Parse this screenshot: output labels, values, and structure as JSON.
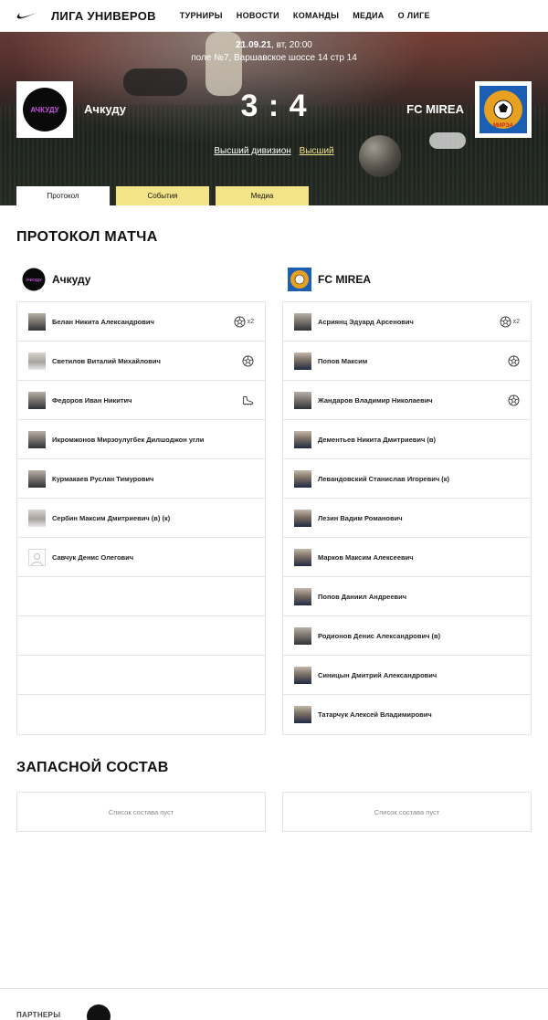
{
  "header": {
    "brand": "ЛИГА УНИВЕРОВ",
    "nav": [
      "ТУРНИРЫ",
      "НОВОСТИ",
      "КОМАНДЫ",
      "МЕДИА",
      "О ЛИГЕ"
    ]
  },
  "match": {
    "date": "21.09.21",
    "date_suffix": ", вт, 20:00",
    "venue": "поле №7, Варшавское шоссе 14 стр 14",
    "home_team": "Ачкуду",
    "away_team": "FC MIREA",
    "score": "3 : 4",
    "division_link_1": "Высший дивизион",
    "division_link_2": "Высший",
    "home_logo_text": "АЧКУДУ",
    "away_logo_text": "МИРЭА"
  },
  "tabs": [
    "Протокол",
    "События",
    "Медиа"
  ],
  "protocol": {
    "title": "ПРОТОКОЛ МАТЧА",
    "home": [
      {
        "name": "Белан Никита Александрович",
        "event": "goal",
        "count": "x2",
        "avatar": "dark"
      },
      {
        "name": "Светилов Виталий Михайлович",
        "event": "goal",
        "count": "",
        "avatar": "light"
      },
      {
        "name": "Федоров Иван Никитич",
        "event": "boot",
        "count": "",
        "avatar": "dark"
      },
      {
        "name": "Икромжонов Мирзоулугбек Дилшоджон угли",
        "event": "",
        "count": "",
        "avatar": "dark"
      },
      {
        "name": "Курмакаев Руслан Тимурович",
        "event": "",
        "count": "",
        "avatar": "dark"
      },
      {
        "name": "Сербин Максим Дмитриевич (в) (к)",
        "event": "",
        "count": "",
        "avatar": "light"
      },
      {
        "name": "Савчук Денис Олегович",
        "event": "",
        "count": "",
        "avatar": "placeholder"
      },
      {
        "name": "",
        "event": "",
        "count": "",
        "avatar": "none"
      },
      {
        "name": "",
        "event": "",
        "count": "",
        "avatar": "none"
      },
      {
        "name": "",
        "event": "",
        "count": "",
        "avatar": "none"
      },
      {
        "name": "",
        "event": "",
        "count": "",
        "avatar": "none"
      }
    ],
    "away": [
      {
        "name": "Асриянц Эдуард Арсенович",
        "event": "goal",
        "count": "x2",
        "avatar": "dark"
      },
      {
        "name": "Попов Максим",
        "event": "goal",
        "count": "",
        "avatar": "navy"
      },
      {
        "name": "Жандаров Владимир Николаевич",
        "event": "goal",
        "count": "",
        "avatar": "dark"
      },
      {
        "name": "Дементьев Никита Дмитриевич (в)",
        "event": "",
        "count": "",
        "avatar": "navy"
      },
      {
        "name": "Левандовский Станислав Игоревич (к)",
        "event": "",
        "count": "",
        "avatar": "navy"
      },
      {
        "name": "Лезин Вадим Романович",
        "event": "",
        "count": "",
        "avatar": "navy"
      },
      {
        "name": "Марков Максим Алексеевич",
        "event": "",
        "count": "",
        "avatar": "navy"
      },
      {
        "name": "Попов Даниил Андреевич",
        "event": "",
        "count": "",
        "avatar": "navy"
      },
      {
        "name": "Родионов Денис Александрович (в)",
        "event": "",
        "count": "",
        "avatar": "dark"
      },
      {
        "name": "Синицын Дмитрий Александрович",
        "event": "",
        "count": "",
        "avatar": "navy"
      },
      {
        "name": "Татарчук Алексей Владимирович",
        "event": "",
        "count": "",
        "avatar": "navy"
      }
    ]
  },
  "reserves": {
    "title": "ЗАПАСНОЙ СОСТАВ",
    "home_empty": "Список состава пуст",
    "away_empty": "Список состава пуст"
  },
  "footer": {
    "partners_label": "ПАРТНЕРЫ"
  },
  "colors": {
    "tab_yellow": "#f3e48a",
    "border": "#e4e4e4"
  }
}
